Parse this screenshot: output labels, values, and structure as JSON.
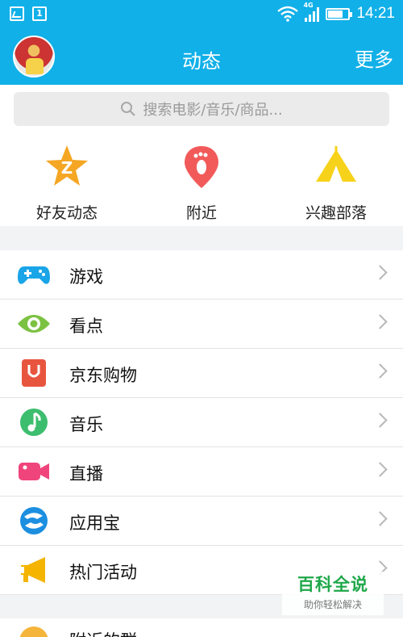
{
  "status_bar": {
    "time": "14:21",
    "network": "4G",
    "notification_number": "1",
    "battery_level": 0.75
  },
  "header": {
    "title": "动态",
    "more_label": "更多"
  },
  "search": {
    "placeholder": "搜索电影/音乐/商品..."
  },
  "quick_actions": [
    {
      "label": "好友动态",
      "icon": "star-z-icon",
      "color": "#f5a623"
    },
    {
      "label": "附近",
      "icon": "footprint-pin-icon",
      "color": "#f25a5a"
    },
    {
      "label": "兴趣部落",
      "icon": "tent-icon",
      "color": "#f7d21a"
    }
  ],
  "menu": [
    {
      "label": "游戏",
      "icon": "gamepad-icon",
      "color": "#1aa5e8"
    },
    {
      "label": "看点",
      "icon": "eye-icon",
      "color": "#7cc242"
    },
    {
      "label": "京东购物",
      "icon": "shopping-bag-icon",
      "color": "#e8553f"
    },
    {
      "label": "音乐",
      "icon": "music-icon",
      "color": "#3dbd6e"
    },
    {
      "label": "直播",
      "icon": "video-camera-icon",
      "color": "#f0457c"
    },
    {
      "label": "应用宝",
      "icon": "app-store-icon",
      "color": "#1c8fe0"
    },
    {
      "label": "热门活动",
      "icon": "megaphone-icon",
      "color": "#f4b400"
    }
  ],
  "menu2": [
    {
      "label": "附近的群",
      "icon": "nearby-group-icon",
      "color": "#f4b53a"
    }
  ],
  "watermark": {
    "title": "百科全说",
    "subtitle": "助你轻松解决"
  }
}
